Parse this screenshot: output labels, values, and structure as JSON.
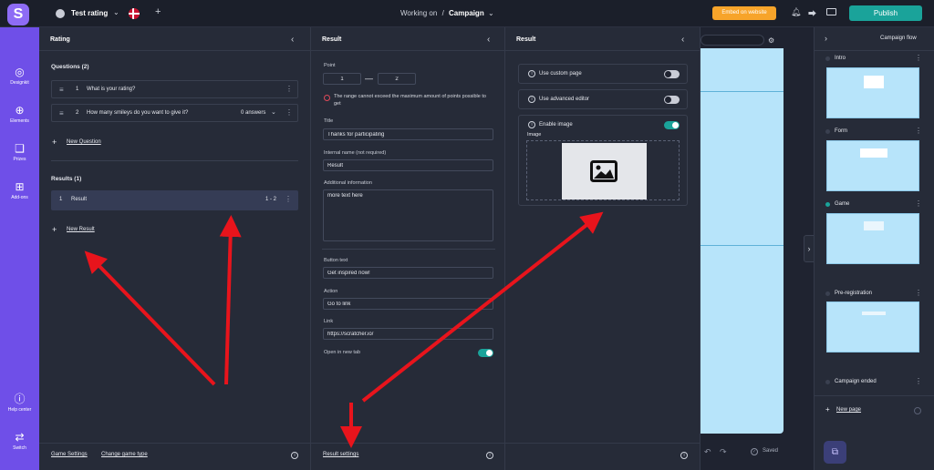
{
  "topbar": {
    "campaign_name": "Test rating",
    "working_on_label": "Working on",
    "separator": "/",
    "context": "Campaign",
    "embed_label": "Embed on website",
    "publish_label": "Publish",
    "add_symbol": "+"
  },
  "sidebar": {
    "items": [
      {
        "label": "Designkit",
        "icon": "palette-icon"
      },
      {
        "label": "Elements",
        "icon": "plus-circle-icon"
      },
      {
        "label": "Prizes",
        "icon": "gift-icon"
      },
      {
        "label": "Add-ons",
        "icon": "grid-plus-icon"
      },
      {
        "label": "Help center",
        "icon": "question-icon"
      },
      {
        "label": "Switch",
        "icon": "swap-icon"
      }
    ]
  },
  "rating_panel": {
    "title": "Rating",
    "questions_heading": "Questions (2)",
    "questions": [
      {
        "num": "1",
        "text": "What is your rating?"
      },
      {
        "num": "2",
        "text": "How many smileys do you want to give it?",
        "answers": "0 answers"
      }
    ],
    "new_question": "New Question",
    "results_heading": "Results (1)",
    "results": [
      {
        "num": "1",
        "text": "Result",
        "range": "1 - 2"
      }
    ],
    "new_result": "New Result",
    "footer_links": [
      "Game Settings",
      "Change game type"
    ]
  },
  "result_panel": {
    "title": "Result",
    "point_label": "Point",
    "point_min": "1",
    "point_max": "2",
    "point_dash": "—",
    "error_text": "The range cannot exceed the maximum amount of points possible to get",
    "title_label": "Title",
    "title_value": "Thanks for participating",
    "internal_label": "Internal name (not required)",
    "internal_value": "Result",
    "additional_label": "Additional information",
    "additional_value": "more text here",
    "button_text_label": "Button text",
    "button_text_value": "Get inspired now!",
    "action_label": "Action",
    "action_value": "Go to link",
    "link_label": "Link",
    "link_value": "https://scratcher.io/",
    "new_tab_label": "Open in new tab",
    "footer_link": "Result settings"
  },
  "result_settings_panel": {
    "title": "Result",
    "options": [
      {
        "label": "Use custom page",
        "on": false
      },
      {
        "label": "Use advanced editor",
        "on": false
      },
      {
        "label": "Enable image",
        "on": true
      }
    ],
    "image_label": "Image"
  },
  "preview": {
    "saved_label": "Saved"
  },
  "campaign_flow": {
    "title": "Campaign flow",
    "pages": [
      {
        "label": "Intro",
        "active": false
      },
      {
        "label": "Form",
        "active": false
      },
      {
        "label": "Game",
        "active": true
      },
      {
        "label": "Pre-registration",
        "active": false
      },
      {
        "label": "Campaign ended",
        "active": false
      }
    ],
    "new_page": "New page"
  },
  "colors": {
    "accent": "#6f4fe8",
    "publish": "#1aa39a",
    "embed": "#f7a42a",
    "annotation_arrow": "#e8141c",
    "preview_bg": "#b7e4fa"
  }
}
